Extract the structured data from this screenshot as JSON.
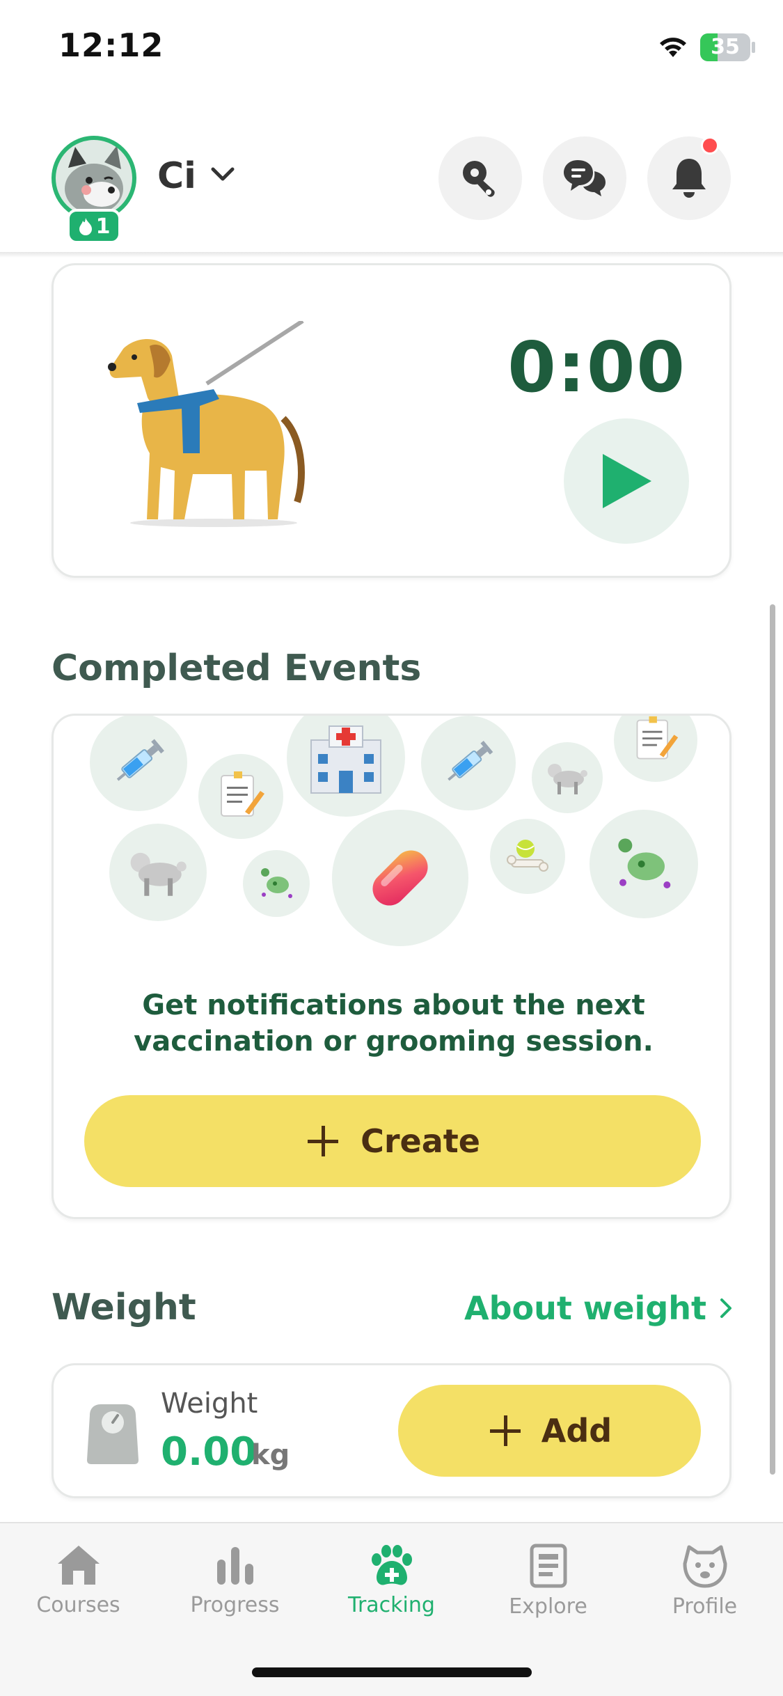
{
  "status_bar": {
    "time": "12:12",
    "battery": "35"
  },
  "header": {
    "pet_name": "Ci",
    "streak_count": "1",
    "buttons": [
      "clicker-icon",
      "chat-icon",
      "bell-icon"
    ],
    "has_notification": true
  },
  "timer": {
    "display": "0:00"
  },
  "events": {
    "title": "Completed Events",
    "message": "Get notifications about the next vaccination or grooming session.",
    "create_label": "Create"
  },
  "weight": {
    "section_title": "Weight",
    "about_link": "About weight",
    "label": "Weight",
    "value": "0.00",
    "unit": "kg",
    "add_label": "Add"
  },
  "tabs": [
    {
      "label": "Courses",
      "icon": "home-icon",
      "active": false
    },
    {
      "label": "Progress",
      "icon": "bar-chart-icon",
      "active": false
    },
    {
      "label": "Tracking",
      "icon": "paw-plus-icon",
      "active": true
    },
    {
      "label": "Explore",
      "icon": "document-icon",
      "active": false
    },
    {
      "label": "Profile",
      "icon": "dog-face-icon",
      "active": false
    }
  ],
  "colors": {
    "accent": "#1fb06f",
    "primary_button": "#f4e066",
    "timer_text": "#1e5c3d"
  }
}
